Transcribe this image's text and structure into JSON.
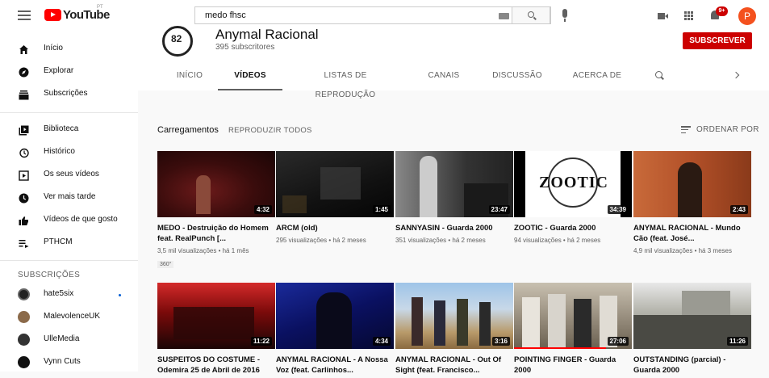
{
  "topbar": {
    "logo_text": "YouTube",
    "logo_region": "PT",
    "search_value": "medo fhsc",
    "notification_count": "9+",
    "avatar_letter": "P"
  },
  "sidebar": {
    "items": [
      {
        "label": "Início",
        "icon": "home-icon"
      },
      {
        "label": "Explorar",
        "icon": "compass-icon"
      },
      {
        "label": "Subscrições",
        "icon": "subscriptions-icon"
      },
      {
        "label": "Biblioteca",
        "icon": "library-icon"
      },
      {
        "label": "Histórico",
        "icon": "history-icon"
      },
      {
        "label": "Os seus vídeos",
        "icon": "your-videos-icon"
      },
      {
        "label": "Ver mais tarde",
        "icon": "clock-icon"
      },
      {
        "label": "Vídeos de que gosto",
        "icon": "thumb-up-icon"
      },
      {
        "label": "PTHCM",
        "icon": "playlist-icon"
      }
    ],
    "subs_heading": "SUBSCRIÇÕES",
    "subscriptions": [
      {
        "label": "hate5six"
      },
      {
        "label": "MalevolenceUK"
      },
      {
        "label": "UlleMedia"
      },
      {
        "label": "Vynn Cuts"
      }
    ]
  },
  "channel": {
    "name": "Anymal Racional",
    "subscribers": "395 subscritores",
    "subscribe_label": "SUBSCREVER",
    "tabs": [
      "INÍCIO",
      "VÍDEOS",
      "LISTAS DE REPRODUÇÃO",
      "CANAIS",
      "DISCUSSÃO",
      "ACERCA DE"
    ]
  },
  "section": {
    "title": "Carregamentos",
    "play_all": "REPRODUZIR TODOS",
    "sort": "ORDENAR POR"
  },
  "videos": [
    {
      "title": "MEDO - Destruição do Homem feat. RealPunch [...",
      "meta": "3,5 mil visualizações • há 1 mês",
      "duration": "4:32",
      "badge": "360°"
    },
    {
      "title": "ARCM (old)",
      "meta": "295 visualizações • há 2 meses",
      "duration": "1:45"
    },
    {
      "title": "SANNYASIN - Guarda 2000",
      "meta": "351 visualizações • há 2 meses",
      "duration": "23:47"
    },
    {
      "title": "ZOOTIC - Guarda 2000",
      "meta": "94 visualizações • há 2 meses",
      "duration": "34:39",
      "thumb_text": "ZOOTIC"
    },
    {
      "title": "ANYMAL RACIONAL - Mundo Cão (feat. José...",
      "meta": "4,9 mil visualizações • há 3 meses",
      "duration": "2:43"
    },
    {
      "title": "SUSPEITOS DO COSTUME - Odemira 25 de Abril de 2016",
      "meta": "",
      "duration": "11:22"
    },
    {
      "title": "ANYMAL RACIONAL - A Nossa Voz (feat. Carlinhos...",
      "meta": "",
      "duration": "4:34"
    },
    {
      "title": "ANYMAL RACIONAL - Out Of Sight (feat. Francisco...",
      "meta": "",
      "duration": "3:16"
    },
    {
      "title": "POINTING FINGER - Guarda 2000",
      "meta": "",
      "duration": "27:06",
      "watched_fraction": 0.78
    },
    {
      "title": "OUTSTANDING (parcial) - Guarda 2000",
      "meta": "",
      "duration": "11:26"
    }
  ]
}
